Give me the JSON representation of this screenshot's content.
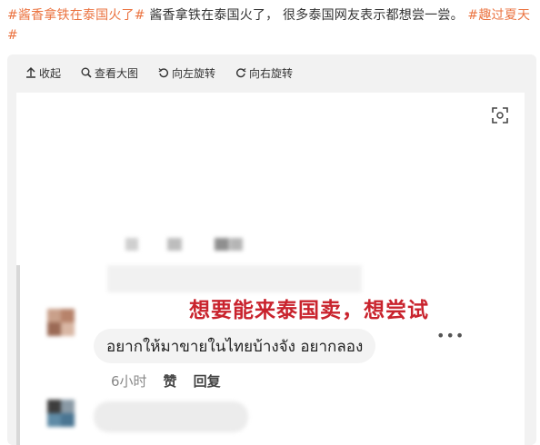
{
  "post": {
    "hashtag1": "#酱香拿铁在泰国火了#",
    "body": " 酱香拿铁在泰国火了， 很多泰国网友表示都想尝一尝。 ",
    "hashtag2": "#趣过夏天#"
  },
  "toolbar": {
    "collapse": "收起",
    "view_large": "查看大图",
    "rotate_left": "向左旋转",
    "rotate_right": "向右旋转"
  },
  "image": {
    "caption": "想要能来泰国卖，想尝试",
    "comment_text": "อยากให้มาขายในไทยบ้างจัง อยากลอง",
    "more": "•••",
    "time": "6小时",
    "like": "赞",
    "reply": "回复"
  },
  "colors": {
    "hashtag": "#eb7340",
    "caption": "#c9232d",
    "panel_bg": "#f2f2f2"
  },
  "icons": [
    "collapse-arrow-icon",
    "magnifier-icon",
    "rotate-left-icon",
    "rotate-right-icon",
    "expand-icon"
  ]
}
